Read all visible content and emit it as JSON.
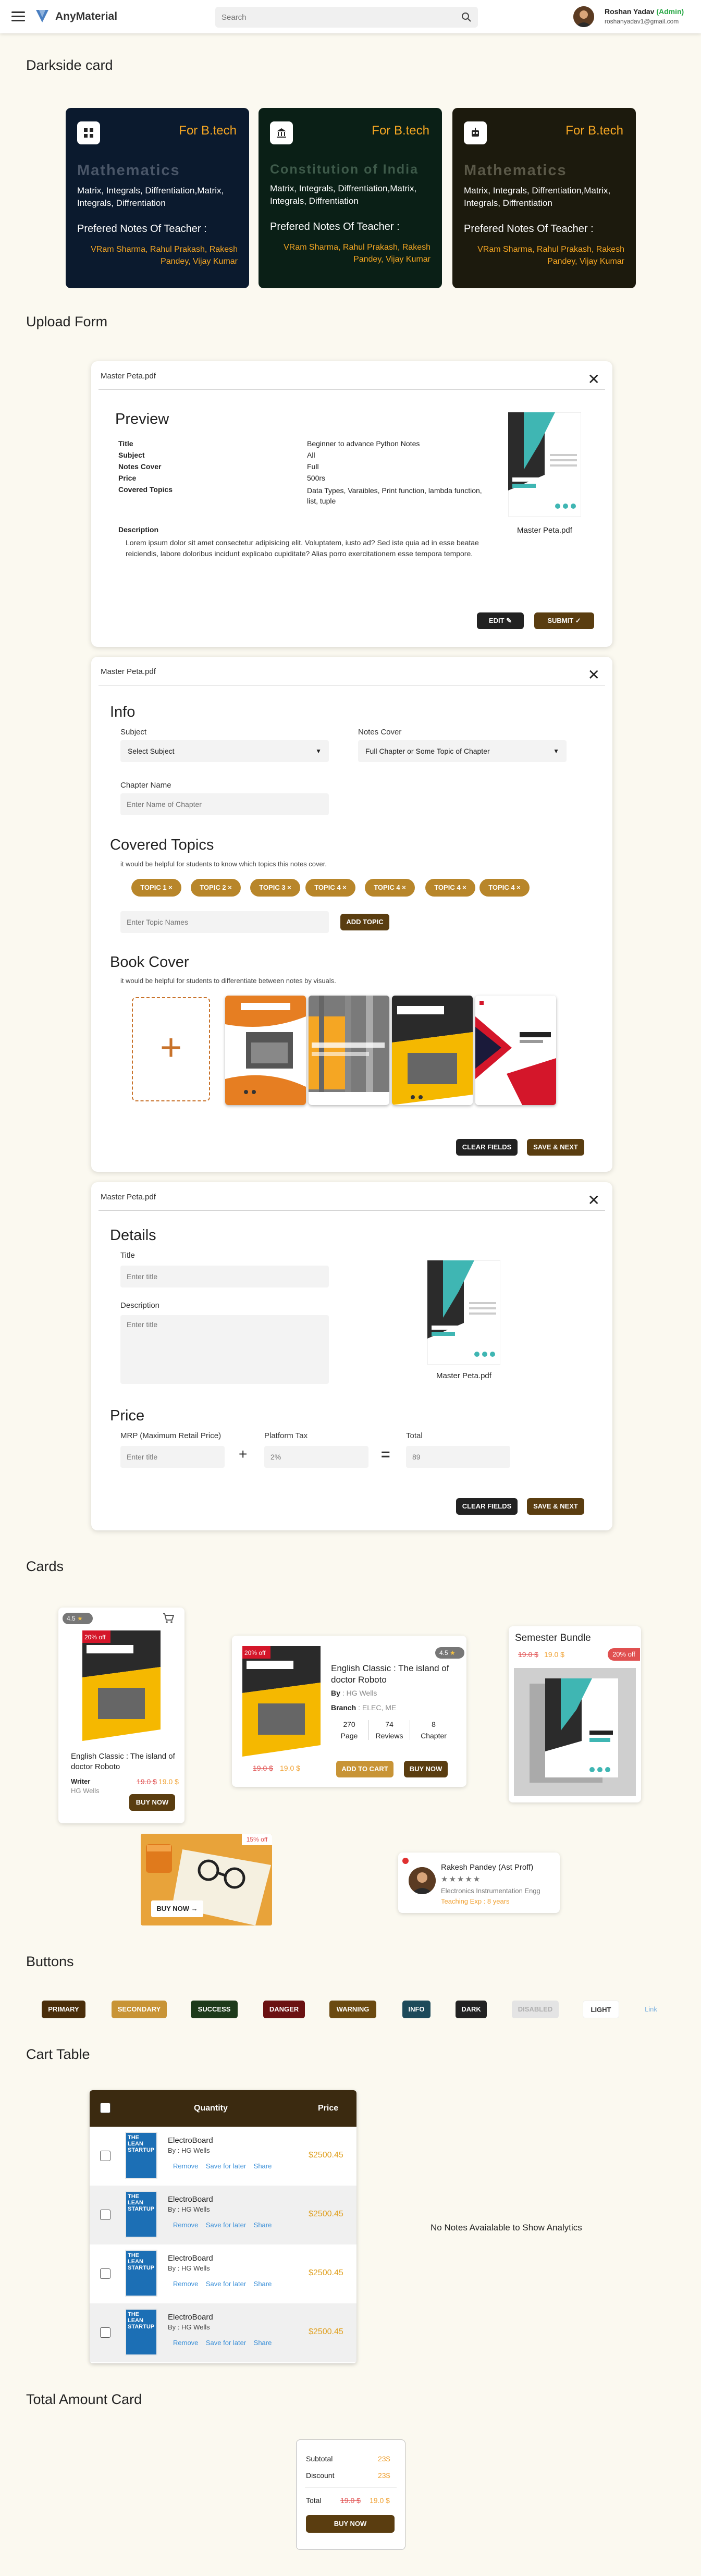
{
  "topbar": {
    "brand": "AnyMaterial",
    "search_placeholder": "Search",
    "user_name": "Roshan Yadav",
    "user_role": "(Admin)",
    "user_email": "roshanyadav1@gmail.com"
  },
  "darkside": {
    "heading": "Darkside card",
    "cards": [
      {
        "tag": "For B.tech",
        "subject": "Mathematics",
        "desc": "Matrix, Integrals, Diffrentiation,Matrix, Integrals, Diffrentiation",
        "pref": "Prefered Notes Of Teacher :",
        "teachers": "VRam Sharma, Rahul Prakash, Rakesh Pandey, Vijay Kumar",
        "bg": "#0b1a2e",
        "subjcolor": "#4a5668"
      },
      {
        "tag": "For B.tech",
        "subject": "Constitution of India",
        "desc": "Matrix, Integrals, Diffrentiation,Matrix, Integrals, Diffrentiation",
        "pref": "Prefered Notes Of Teacher :",
        "teachers": "VRam Sharma, Rahul Prakash, Rakesh Pandey, Vijay Kumar",
        "bg": "#0a1f16",
        "subjcolor": "#3e5a4a"
      },
      {
        "tag": "For B.tech",
        "subject": "Mathematics",
        "desc": "Matrix, Integrals, Diffrentiation,Matrix, Integrals, Diffrentiation",
        "pref": "Prefered Notes Of Teacher :",
        "teachers": "VRam Sharma, Rahul Prakash, Rakesh Pandey, Vijay Kumar",
        "bg": "#1c1a0d",
        "subjcolor": "#5a5848"
      }
    ]
  },
  "upload": {
    "heading": "Upload Form",
    "preview": {
      "file": "Master Peta.pdf",
      "title": "Preview",
      "rows": [
        {
          "k": "Title",
          "v": "Beginner to advance Python Notes"
        },
        {
          "k": "Subject",
          "v": "All"
        },
        {
          "k": "Notes Cover",
          "v": "Full"
        },
        {
          "k": "Price",
          "v": "500rs"
        },
        {
          "k": "Covered Topics",
          "v": "Data Types, Varaibles, Print function, lambda function, list, tuple"
        }
      ],
      "desc_label": "Description",
      "desc": "Lorem ipsum dolor sit amet consectetur adipisicing elit. Voluptatem, iusto ad? Sed iste quia ad in esse beatae reiciendis, labore doloribus incidunt explicabo cupiditate? Alias porro exercitationem esse tempora tempore.",
      "cover_caption": "Master Peta.pdf",
      "edit": "EDIT",
      "submit": "SUBMIT"
    },
    "info": {
      "file": "Master Peta.pdf",
      "title": "Info",
      "subject_label": "Subject",
      "subject_value": "Select Subject",
      "cover_label": "Notes Cover",
      "cover_value": "Full Chapter or Some Topic of Chapter",
      "chapter_label": "Chapter Name",
      "chapter_placeholder": "Enter Name of Chapter",
      "topics_title": "Covered Topics",
      "topics_hint": "it would be helpful for students to know which topics this notes cover.",
      "chips": [
        "TOPIC 1 ×",
        "TOPIC 2 ×",
        "TOPIC 3 ×",
        "TOPIC 4 ×",
        "TOPIC 4 ×",
        "TOPIC 4 ×",
        "TOPIC 4 ×"
      ],
      "topic_placeholder": "Enter Topic Names",
      "add_topic": "ADD TOPIC",
      "cover_title": "Book Cover",
      "cover_hint": "it would be helpful for students to differentiate between notes by visuals.",
      "clear": "CLEAR FIELDS",
      "save": "SAVE & NEXT"
    },
    "details": {
      "file": "Master Peta.pdf",
      "title": "Details",
      "t_label": "Title",
      "t_placeholder": "Enter title",
      "d_label": "Description",
      "d_placeholder": "Enter title",
      "cover_caption": "Master Peta.pdf",
      "price_title": "Price",
      "mrp_label": "MRP (Maximum Retail Price)",
      "mrp_placeholder": "Enter title",
      "tax_label": "Platform Tax",
      "tax_placeholder": "2%",
      "total_label": "Total",
      "total_placeholder": "89",
      "clear": "CLEAR FIELDS",
      "save": "SAVE & NEXT"
    }
  },
  "cards": {
    "heading": "Cards",
    "card1": {
      "rating": "4.5",
      "discount": "20% off",
      "title": "English Classic : The island of doctor Roboto",
      "writer_label": "Writer",
      "writer": "HG Wells",
      "old": "19.0 $",
      "new": "19.0 $",
      "buy": "BUY NOW"
    },
    "card2": {
      "rating": "4.5",
      "discount": "20% off",
      "title": "English Classic : The island of doctor Roboto",
      "by_label": "By",
      "by": "HG Wells",
      "branch_label": "Branch",
      "branch": "ELEC, ME",
      "stats": [
        {
          "n": "270",
          "l": "Page"
        },
        {
          "n": "74",
          "l": "Reviews"
        },
        {
          "n": "8",
          "l": "Chapter"
        }
      ],
      "old": "19.0 $",
      "new": "19.0 $",
      "cart": "ADD TO CART",
      "buy": "BUY NOW"
    },
    "card3": {
      "title": "Semester Bundle",
      "old": "19.0 $",
      "new": "19.0 $",
      "off": "20% off"
    },
    "card4": {
      "off": "15% off",
      "buy": "BUY NOW →"
    },
    "card5": {
      "name": "Rakesh Pandey (Ast Proff)",
      "stars": "★★★★★",
      "dept": "Electronics Instrumentation Engg",
      "exp": "Teaching Exp : 8 years"
    }
  },
  "buttons": {
    "heading": "Buttons",
    "items": [
      "PRIMARY",
      "SECONDARY",
      "SUCCESS",
      "DANGER",
      "WARNING",
      "INFO",
      "DARK",
      "DISABLED",
      "LIGHT",
      "Link"
    ]
  },
  "cart": {
    "heading": "Cart Table",
    "col_qty": "Quantity",
    "col_price": "Price",
    "cover_text": "THE LEAN STARTUP",
    "rows": [
      {
        "title": "ElectroBoard",
        "by": "By : HG Wells",
        "remove": "Remove",
        "save": "Save for later",
        "share": "Share",
        "price": "$2500.45"
      },
      {
        "title": "ElectroBoard",
        "by": "By : HG Wells",
        "remove": "Remove",
        "save": "Save for later",
        "share": "Share",
        "price": "$2500.45"
      },
      {
        "title": "ElectroBoard",
        "by": "By : HG Wells",
        "remove": "Remove",
        "save": "Save for later",
        "share": "Share",
        "price": "$2500.45"
      },
      {
        "title": "ElectroBoard",
        "by": "By : HG Wells",
        "remove": "Remove",
        "save": "Save for later",
        "share": "Share",
        "price": "$2500.45"
      }
    ],
    "empty": "No Notes Avaialable to Show Analytics"
  },
  "total": {
    "heading": "Total Amount Card",
    "subtotal_label": "Subtotal",
    "subtotal": "23$",
    "discount_label": "Discount",
    "discount": "23$",
    "total_label": "Total",
    "old": "19.0 $",
    "new": "19.0 $",
    "buy": "BUY NOW"
  }
}
